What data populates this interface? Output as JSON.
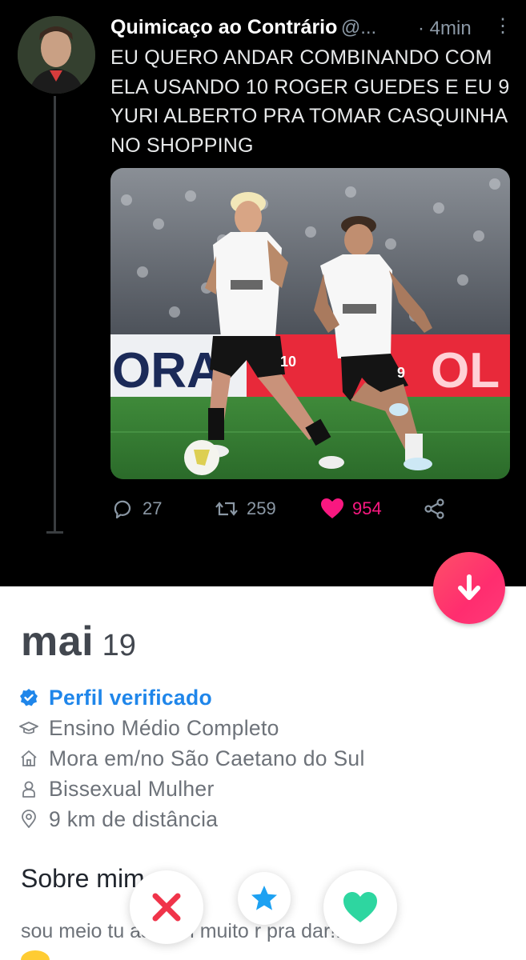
{
  "tweet": {
    "author": "Quimicaço ao Contrário",
    "handle": "@...",
    "time": "· 4min",
    "menu_glyph": "⋮",
    "text": "EU QUERO ANDAR COMBINANDO COM ELA USANDO 10 ROGER GUEDES E EU 9 YURI ALBERTO PRA TOMAR CASQUINHA NO SHOPPING",
    "image": {
      "banner_left": "ORA",
      "banner_right": "OL",
      "jersey_numbers": [
        "10",
        "9"
      ]
    },
    "actions": {
      "replies": "27",
      "retweets": "259",
      "likes": "954"
    }
  },
  "profile": {
    "name": "mai",
    "age": "19",
    "verified_label": "Perfil verificado",
    "education": "Ensino Médio Completo",
    "lives_in": "Mora em/no São Caetano do Sul",
    "orientation": "Bissexual Mulher",
    "distance": "9 km de distância",
    "about_title": "Sobre mim",
    "bio": "sou meio tu  as com muito  r pra dar!!"
  },
  "colors": {
    "like_pink": "#f91880",
    "verified_blue": "#1f86ea",
    "nope_red": "#f0344a",
    "star_blue": "#1da1f2",
    "like_green": "#2ed6a0",
    "fab_gradient_start": "#fd5068"
  },
  "icons": {
    "reply": "speech-bubble-icon",
    "retweet": "retweet-icon",
    "like": "heart-icon",
    "share": "share-icon",
    "scroll_down": "arrow-down-icon",
    "verified": "verified-badge-icon",
    "education": "graduation-cap-icon",
    "home": "house-icon",
    "person": "person-icon",
    "location": "location-pin-icon",
    "nope": "x-icon",
    "super_like": "star-icon",
    "like_button": "heart-icon"
  }
}
